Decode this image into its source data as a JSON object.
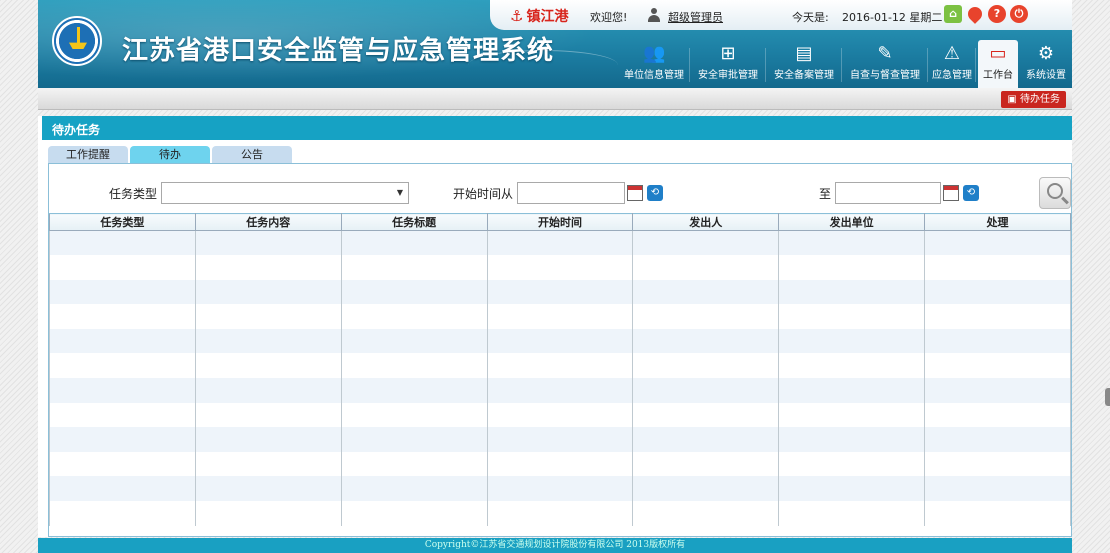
{
  "header": {
    "system_title": "江苏省港口安全监管与应急管理系统",
    "port_name": "镇江港",
    "welcome": "欢迎您!",
    "username": "超级管理员",
    "today_label": "今天是:",
    "date": "2016-01-12 星期二",
    "top_icons": [
      "home-icon",
      "location-pin-icon",
      "help-icon",
      "power-icon"
    ],
    "menu": [
      {
        "label": "单位信息管理",
        "icon": "people-icon"
      },
      {
        "label": "安全审批管理",
        "icon": "org-chart-icon"
      },
      {
        "label": "安全备案管理",
        "icon": "document-icon"
      },
      {
        "label": "自查与督查管理",
        "icon": "inspect-icon"
      },
      {
        "label": "应急管理",
        "icon": "warning-triangle-icon"
      },
      {
        "label": "工作台",
        "icon": "monitor-icon"
      },
      {
        "label": "系统设置",
        "icon": "gear-icon"
      }
    ]
  },
  "subbar": {
    "todo_button": "待办任务"
  },
  "panel": {
    "title": "待办任务",
    "tabs": [
      "工作提醒",
      "待办",
      "公告"
    ],
    "active_tab": "待办",
    "filters": {
      "task_type_label": "任务类型",
      "task_type_value": "",
      "start_from_label": "开始时间从",
      "start_from_value": "",
      "to_label": "至",
      "to_value": ""
    },
    "columns": [
      "任务类型",
      "任务内容",
      "任务标题",
      "开始时间",
      "发出人",
      "发出单位",
      "处理"
    ],
    "row_count": 12
  },
  "footer": {
    "copyright": "Copyright©江苏省交通规划设计院股份有限公司 2013版权所有"
  },
  "colors": {
    "header_blue": "#1c7ea3",
    "panel_head": "#16a2c4",
    "accent_red": "#c9261f",
    "active_tab": "#6ed3ee"
  }
}
